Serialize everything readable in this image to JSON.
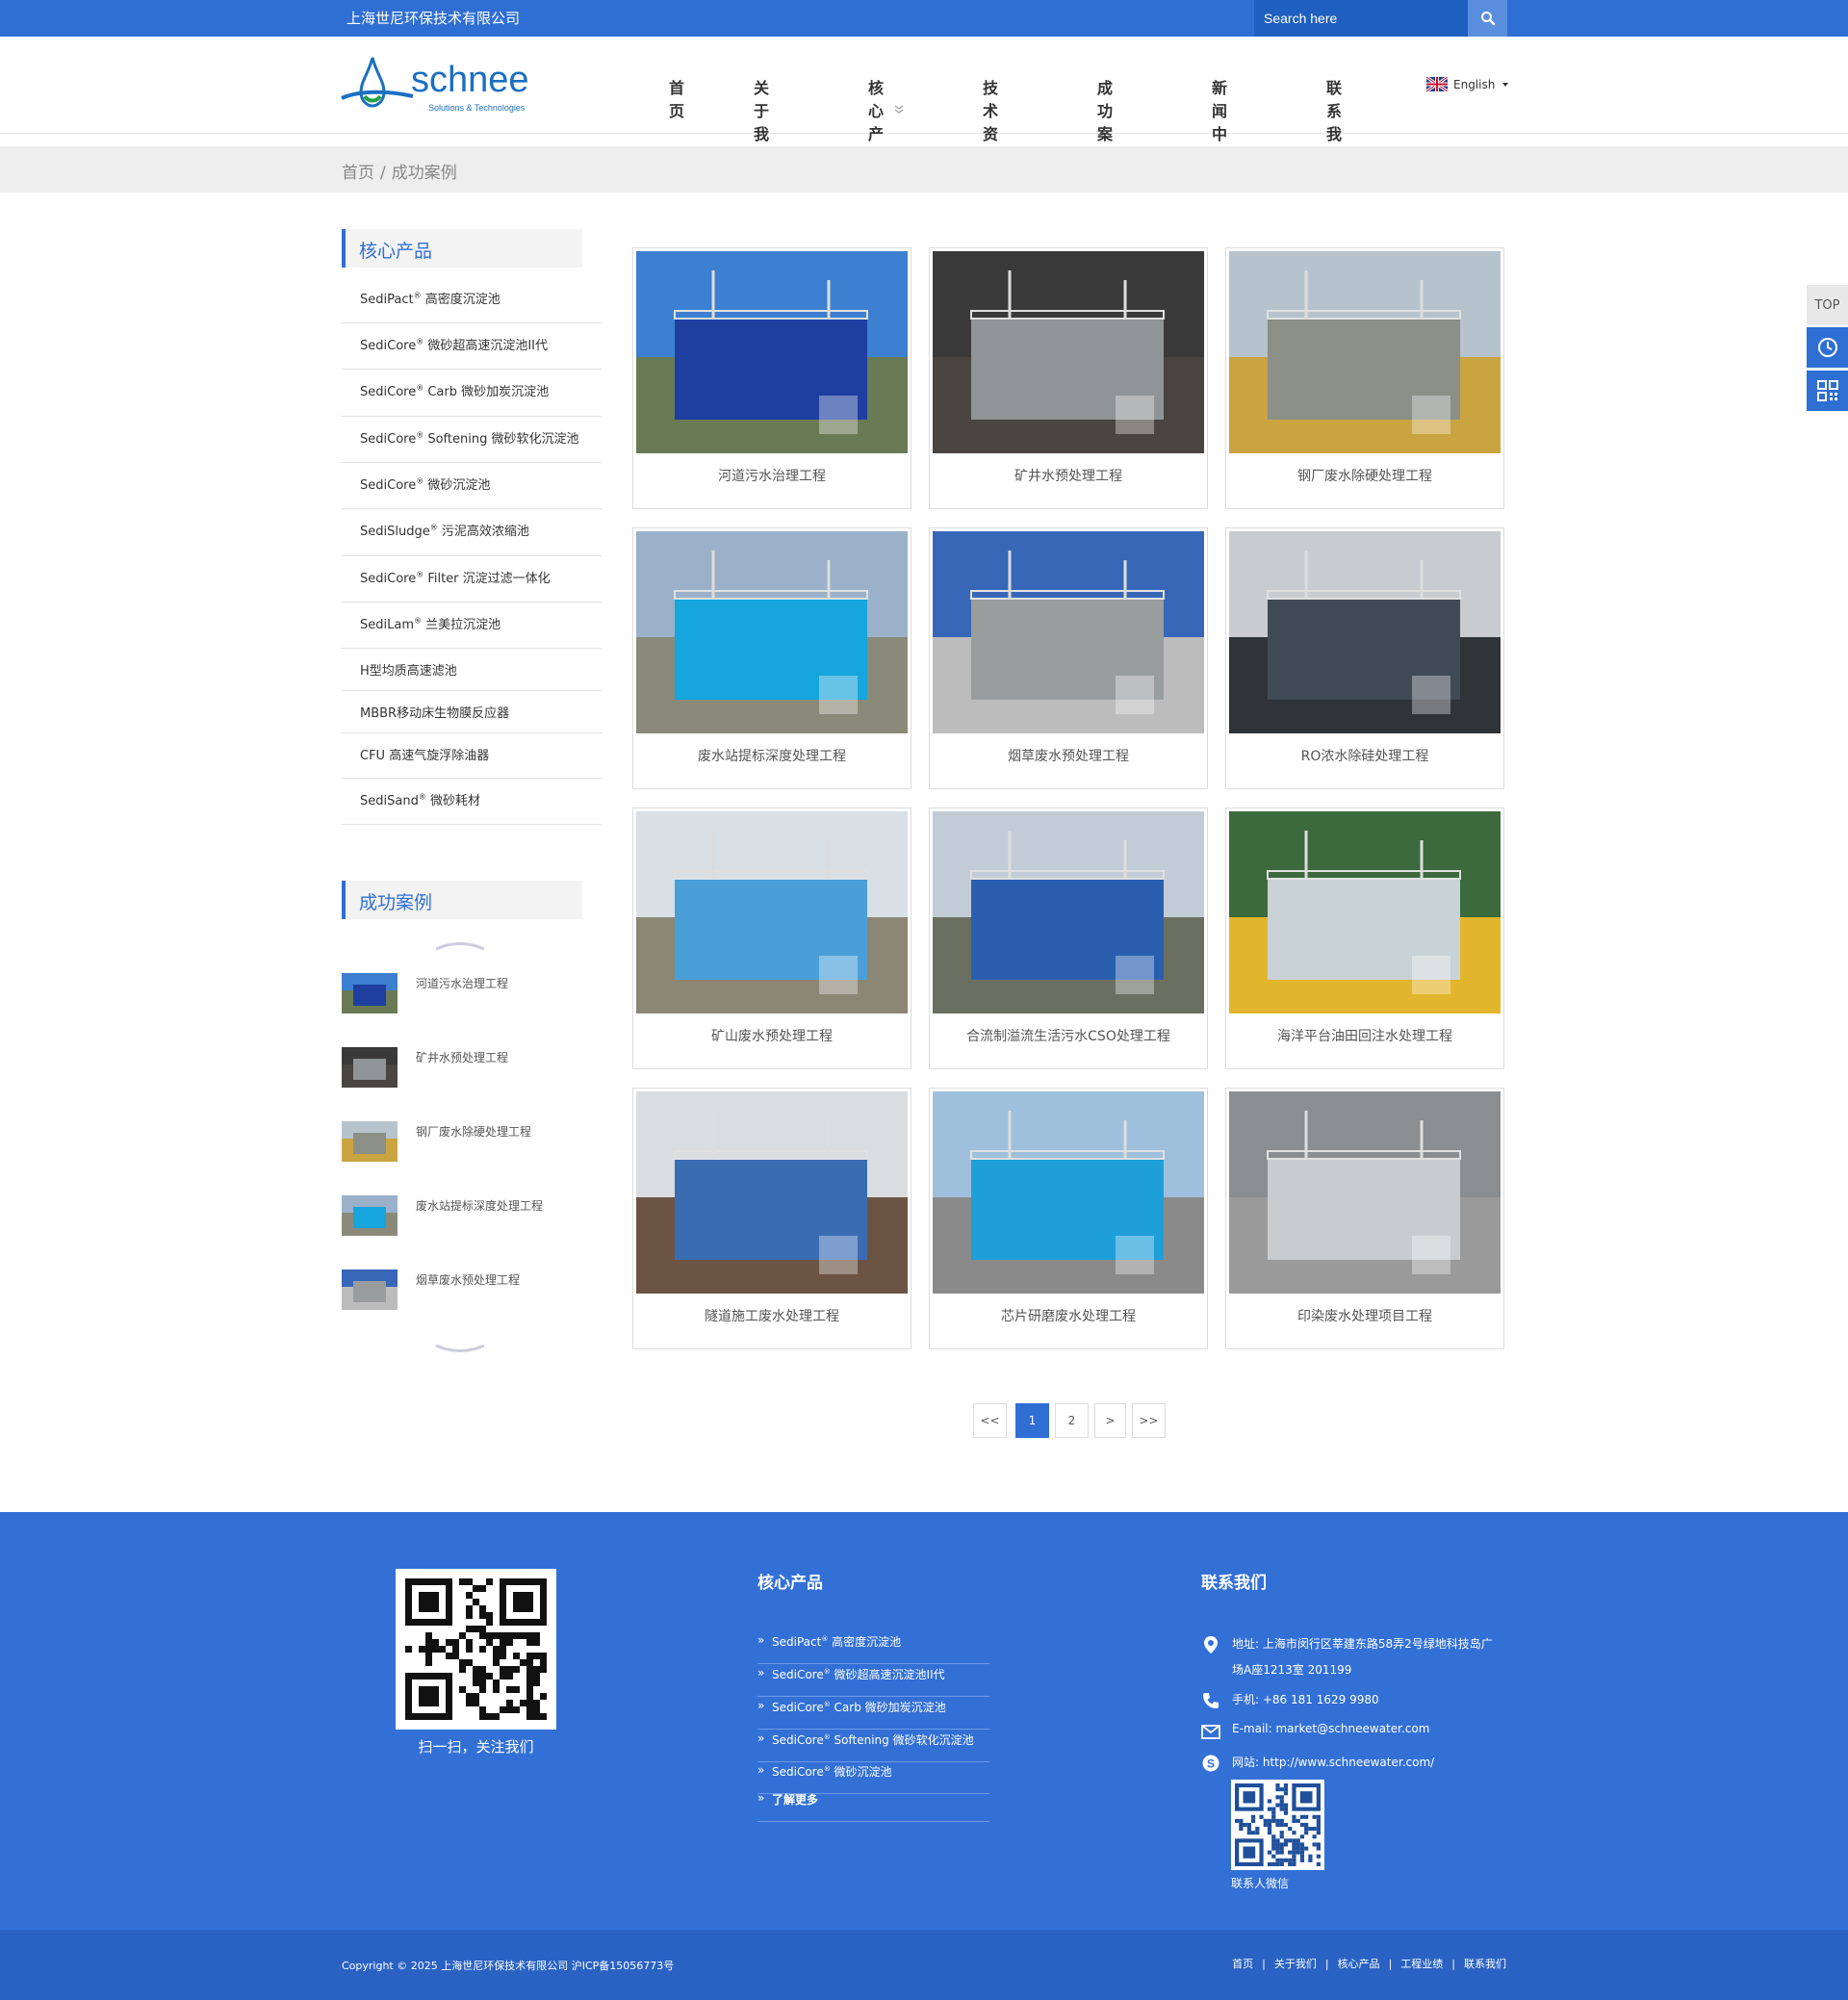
{
  "topbar": {
    "company": "上海世尼环保技术有限公司",
    "search_placeholder": "Search here"
  },
  "logo": {
    "word": "schnee",
    "tagline": "Solutions & Technologies"
  },
  "nav": {
    "items": [
      "首页",
      "关于我们",
      "核心产品",
      "技术资料",
      "成功案例",
      "新闻中心",
      "联系我们"
    ],
    "language": "English"
  },
  "breadcrumb": {
    "home": "首页",
    "sep": "/",
    "current": "成功案例"
  },
  "sidebar": {
    "products_title": "核心产品",
    "products": [
      {
        "brand": "SediPact",
        "reg": "®",
        "rest": " 高密度沉淀池"
      },
      {
        "brand": "SediCore",
        "reg": "®",
        "rest": " 微砂超高速沉淀池II代"
      },
      {
        "brand": "SediCore",
        "reg": "®",
        "rest": " Carb 微砂加炭沉淀池"
      },
      {
        "brand": "SediCore",
        "reg": "®",
        "rest": " Softening 微砂软化沉淀池"
      },
      {
        "brand": "SediCore",
        "reg": "®",
        "rest": " 微砂沉淀池"
      },
      {
        "brand": "SediSludge",
        "reg": "®",
        "rest": " 污泥高效浓缩池"
      },
      {
        "brand": "SediCore",
        "reg": "®",
        "rest": " Filter 沉淀过滤一体化"
      },
      {
        "brand": "SediLam",
        "reg": "®",
        "rest": " 兰美拉沉淀池"
      },
      {
        "brand": "H型均质高速滤池",
        "reg": "",
        "rest": ""
      },
      {
        "brand": "MBBR移动床生物膜反应器",
        "reg": "",
        "rest": ""
      },
      {
        "brand": "CFU 高速气旋浮除油器",
        "reg": "",
        "rest": ""
      },
      {
        "brand": "SediSand",
        "reg": "®",
        "rest": " 微砂耗材"
      }
    ],
    "cases_title": "成功案例",
    "cases": [
      "河道污水治理工程",
      "矿井水预处理工程",
      "钢厂废水除硬处理工程",
      "废水站提标深度处理工程",
      "烟草废水预处理工程"
    ]
  },
  "grid": {
    "cards": [
      {
        "caption": "河道污水治理工程",
        "sky": "#3d7fd0",
        "body": "#1f3fa0",
        "ground": "#6a7a55"
      },
      {
        "caption": "矿井水预处理工程",
        "sky": "#3a3a3a",
        "body": "#8f9496",
        "ground": "#4a4540"
      },
      {
        "caption": "钢厂废水除硬处理工程",
        "sky": "#b6c3cc",
        "body": "#8b8f86",
        "ground": "#c9a441"
      },
      {
        "caption": "废水站提标深度处理工程",
        "sky": "#9ab1c9",
        "body": "#16a5dc",
        "ground": "#8a8a7a"
      },
      {
        "caption": "烟草废水预处理工程",
        "sky": "#3867b8",
        "body": "#9a9d9e",
        "ground": "#bcbcbc"
      },
      {
        "caption": "RO浓水除硅处理工程",
        "sky": "#c8ccd0",
        "body": "#3f4a55",
        "ground": "#2f3438"
      },
      {
        "caption": "矿山废水预处理工程",
        "sky": "#d8e0e6",
        "body": "#4a9fd8",
        "ground": "#8c8675"
      },
      {
        "caption": "合流制溢流生活污水CSO处理工程",
        "sky": "#c2ccd6",
        "body": "#2a5fb0",
        "ground": "#6b6f62"
      },
      {
        "caption": "海洋平台油田回注水处理工程",
        "sky": "#3c6a3d",
        "body": "#c9d2d6",
        "ground": "#e2b62c"
      },
      {
        "caption": "隧道施工废水处理工程",
        "sky": "#d9dde0",
        "body": "#3a6cb2",
        "ground": "#6b5443"
      },
      {
        "caption": "芯片研磨废水处理工程",
        "sky": "#9fc0dc",
        "body": "#1e9fd8",
        "ground": "#8a8a8a"
      },
      {
        "caption": "印染废水处理项目工程",
        "sky": "#8a8e90",
        "body": "#c8ccce",
        "ground": "#9a9a9a"
      }
    ]
  },
  "pager": {
    "first": "<<",
    "p1": "1",
    "p2": "2",
    "next": ">",
    "last": ">>"
  },
  "float": {
    "top": "TOP"
  },
  "footer": {
    "qr_caption": "扫一扫，关注我们",
    "products_title": "核心产品",
    "links": [
      {
        "brand": "SediPact",
        "reg": "®",
        "rest": " 高密度沉淀池"
      },
      {
        "brand": "SediCore",
        "reg": "®",
        "rest": " 微砂超高速沉淀池II代"
      },
      {
        "brand": "SediCore",
        "reg": "®",
        "rest": " Carb 微砂加炭沉淀池"
      },
      {
        "brand": "SediCore",
        "reg": "®",
        "rest": " Softening 微砂软化沉淀池"
      },
      {
        "brand": "SediCore",
        "reg": "®",
        "rest": " 微砂沉淀池"
      },
      {
        "brand": "了解更多",
        "reg": "",
        "rest": ""
      }
    ],
    "contact_title": "联系我们",
    "address_line1": "地址: 上海市闵行区莘建东路58弄2号绿地科技岛广",
    "address_line2": "场A座1213室 201199",
    "phone": "手机: +86 181 1629 9980",
    "email": "E-mail: market@schneewater.com",
    "website": "网站: http://www.schneewater.com/",
    "wechat_caption": "联系人微信",
    "copyright": "Copyright © 2025 上海世尼环保技术有限公司 沪ICP备15056773号",
    "bottom_links": [
      "首页",
      "关于我们",
      "核心产品",
      "工程业绩",
      "联系我们"
    ],
    "link_sep": "|"
  }
}
